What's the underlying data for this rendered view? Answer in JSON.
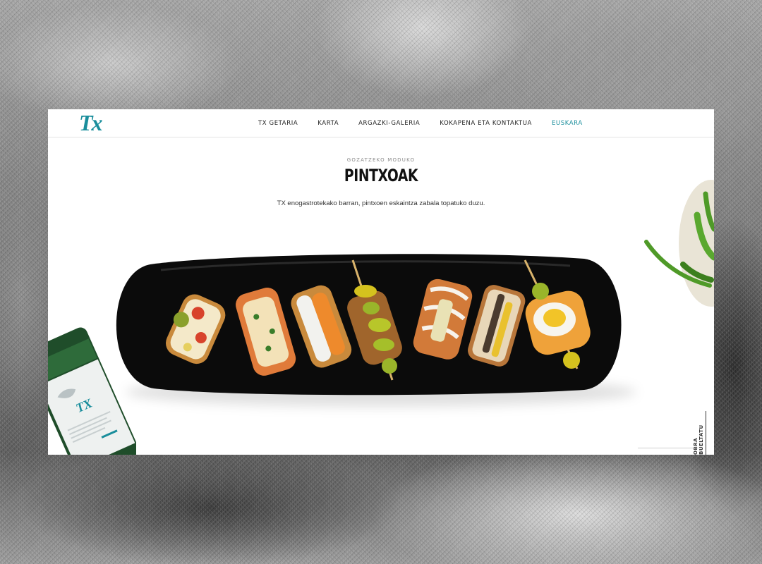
{
  "site": {
    "logo": "Tx",
    "nav": [
      {
        "label": "TX GETARIA",
        "active": false
      },
      {
        "label": "KARTA",
        "active": false
      },
      {
        "label": "ARGAZKI-GALERIA",
        "active": false
      },
      {
        "label": "KOKAPENA ETA KONTAKTUA",
        "active": false
      },
      {
        "label": "EUSKARA",
        "active": true
      }
    ],
    "accent_color": "#1a8e9c"
  },
  "hero": {
    "eyebrow": "GOZATZEKO MODUKO",
    "title": "PINTXOAK",
    "subtitle": "TX enogastrotekako barran, pintxoen eskaintza zabala topatuko duzu."
  },
  "bottle_label": {
    "brand": "TX"
  },
  "side_link": "OBRA BUELTATU",
  "images": {
    "platter": "pintxos-platter",
    "bottle": "txakoli-bottle",
    "peppers": "green-peppers"
  }
}
